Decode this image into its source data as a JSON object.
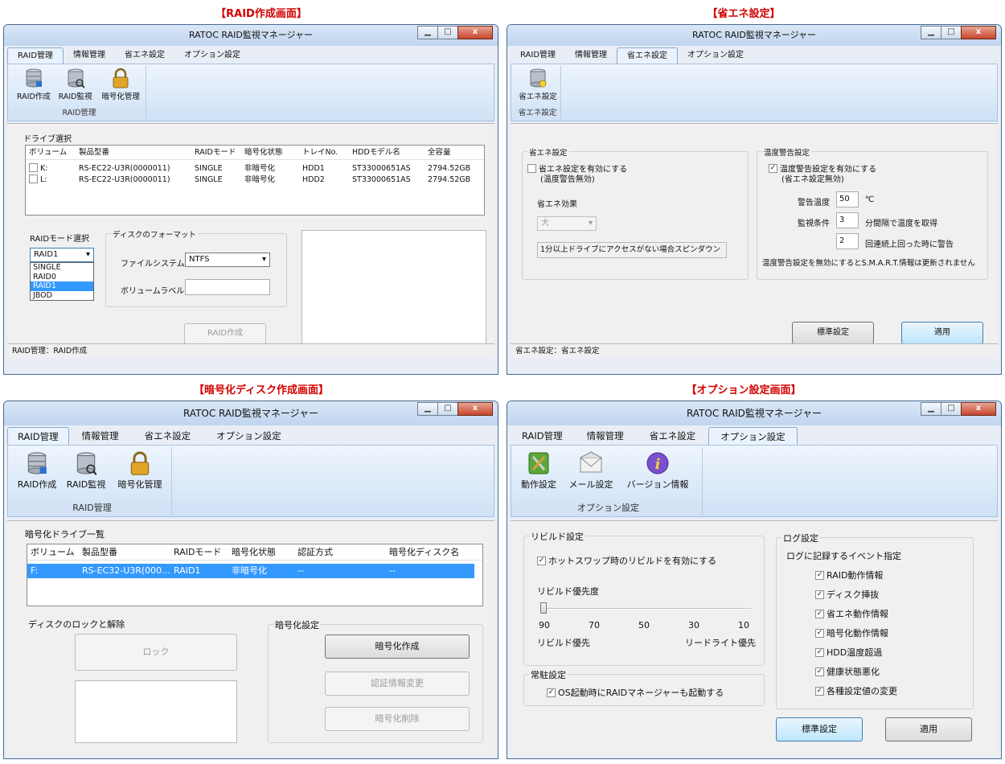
{
  "captions": {
    "tl": "【RAID作成画面】",
    "tr": "【省エネ設定】",
    "bl": "【暗号化ディスク作成画面】",
    "br": "【オプション設定画面】"
  },
  "window_title": "RATOC RAID監視マネージャー",
  "window_controls": {
    "minimize": "▁",
    "maximize": "□",
    "close": "x"
  },
  "tabs": [
    "RAID管理",
    "情報管理",
    "省エネ設定",
    "オプション設定"
  ],
  "raid_group": {
    "label": "RAID管理",
    "buttons": [
      "RAID作成",
      "RAID監視",
      "暗号化管理"
    ]
  },
  "eco_group": {
    "label": "省エネ設定",
    "buttons": [
      "省エネ設定"
    ]
  },
  "option_group": {
    "label": "オプション設定",
    "buttons": [
      "動作設定",
      "メール設定",
      "バージョン情報"
    ]
  },
  "raid_create": {
    "drive_select_label": "ドライブ選択",
    "columns": [
      "ボリューム",
      "製品型番",
      "RAIDモード",
      "暗号化状態",
      "トレイNo.",
      "HDDモデル名",
      "全容量"
    ],
    "rows": [
      [
        "K:",
        "RS-EC22-U3R(0000011)",
        "SINGLE",
        "非暗号化",
        "HDD1",
        "ST33000651AS",
        "2794.52GB"
      ],
      [
        "L:",
        "RS-EC22-U3R(0000011)",
        "SINGLE",
        "非暗号化",
        "HDD2",
        "ST33000651AS",
        "2794.52GB"
      ]
    ],
    "raid_mode_label": "RAIDモード選択",
    "raid_mode_value": "RAID1",
    "raid_mode_options": [
      "SINGLE",
      "RAID0",
      "RAID1",
      "JBOD"
    ],
    "format_label": "ディスクのフォーマット",
    "filesystem_label": "ファイルシステム",
    "filesystem_value": "NTFS",
    "volume_label_label": "ボリュームラベル",
    "create_button": "RAID作成",
    "status": "RAID管理：RAID作成"
  },
  "eco": {
    "eco_section": "省エネ設定",
    "eco_enable": "省エネ設定を有効にする",
    "eco_enable_sub": "(温度警告無効)",
    "eco_effect_label": "省エネ効果",
    "eco_effect_value": "大",
    "eco_desc": "1分以上ドライブにアクセスがない場合スピンダウン",
    "temp_section": "温度警告設定",
    "temp_enable": "温度警告設定を有効にする",
    "temp_enable_sub": "(省エネ設定無効)",
    "warn_temp_label": "警告温度",
    "warn_temp_value": "50",
    "warn_temp_unit": "℃",
    "monitor_label": "監視条件",
    "monitor_value": "3",
    "monitor_unit": "分間隔で温度を取得",
    "repeat_value": "2",
    "repeat_unit": "回連続上回った時に警告",
    "smart_note": "温度警告設定を無効にするとS.M.A.R.T.情報は更新されません",
    "default_button": "標準設定",
    "apply_button": "適用",
    "status": "省エネ設定：省エネ設定"
  },
  "encrypt": {
    "list_label": "暗号化ドライブ一覧",
    "columns": [
      "ボリューム",
      "製品型番",
      "RAIDモード",
      "暗号化状態",
      "認証方式",
      "暗号化ディスク名"
    ],
    "rows": [
      [
        "F:",
        "RS-EC32-U3R(000...",
        "RAID1",
        "非暗号化",
        "--",
        "--"
      ]
    ],
    "lock_section": "ディスクのロックと解除",
    "lock_button": "ロック",
    "enc_section": "暗号化設定",
    "enc_create_button": "暗号化作成",
    "auth_change_button": "認証情報変更",
    "enc_delete_button": "暗号化削除"
  },
  "options": {
    "rebuild_section": "リビルド設定",
    "hotswap_rebuild": "ホットスワップ時のリビルドを有効にする",
    "rebuild_priority_label": "リビルド優先度",
    "rebuild_priority_value": 90,
    "slider_ticks": [
      "90",
      "70",
      "50",
      "30",
      "10"
    ],
    "rebuild_priority_left": "リビルド優先",
    "rebuild_priority_right": "リードライト優先",
    "resident_section": "常駐設定",
    "resident_startup": "OS起動時にRAIDマネージャーも起動する",
    "log_section": "ログ設定",
    "log_events_label": "ログに記録するイベント指定",
    "log_events": [
      "RAID動作情報",
      "ディスク挿抜",
      "省エネ動作情報",
      "暗号化動作情報",
      "HDD温度超過",
      "健康状態悪化",
      "各種設定値の変更"
    ],
    "default_button": "標準設定",
    "apply_button": "適用"
  }
}
